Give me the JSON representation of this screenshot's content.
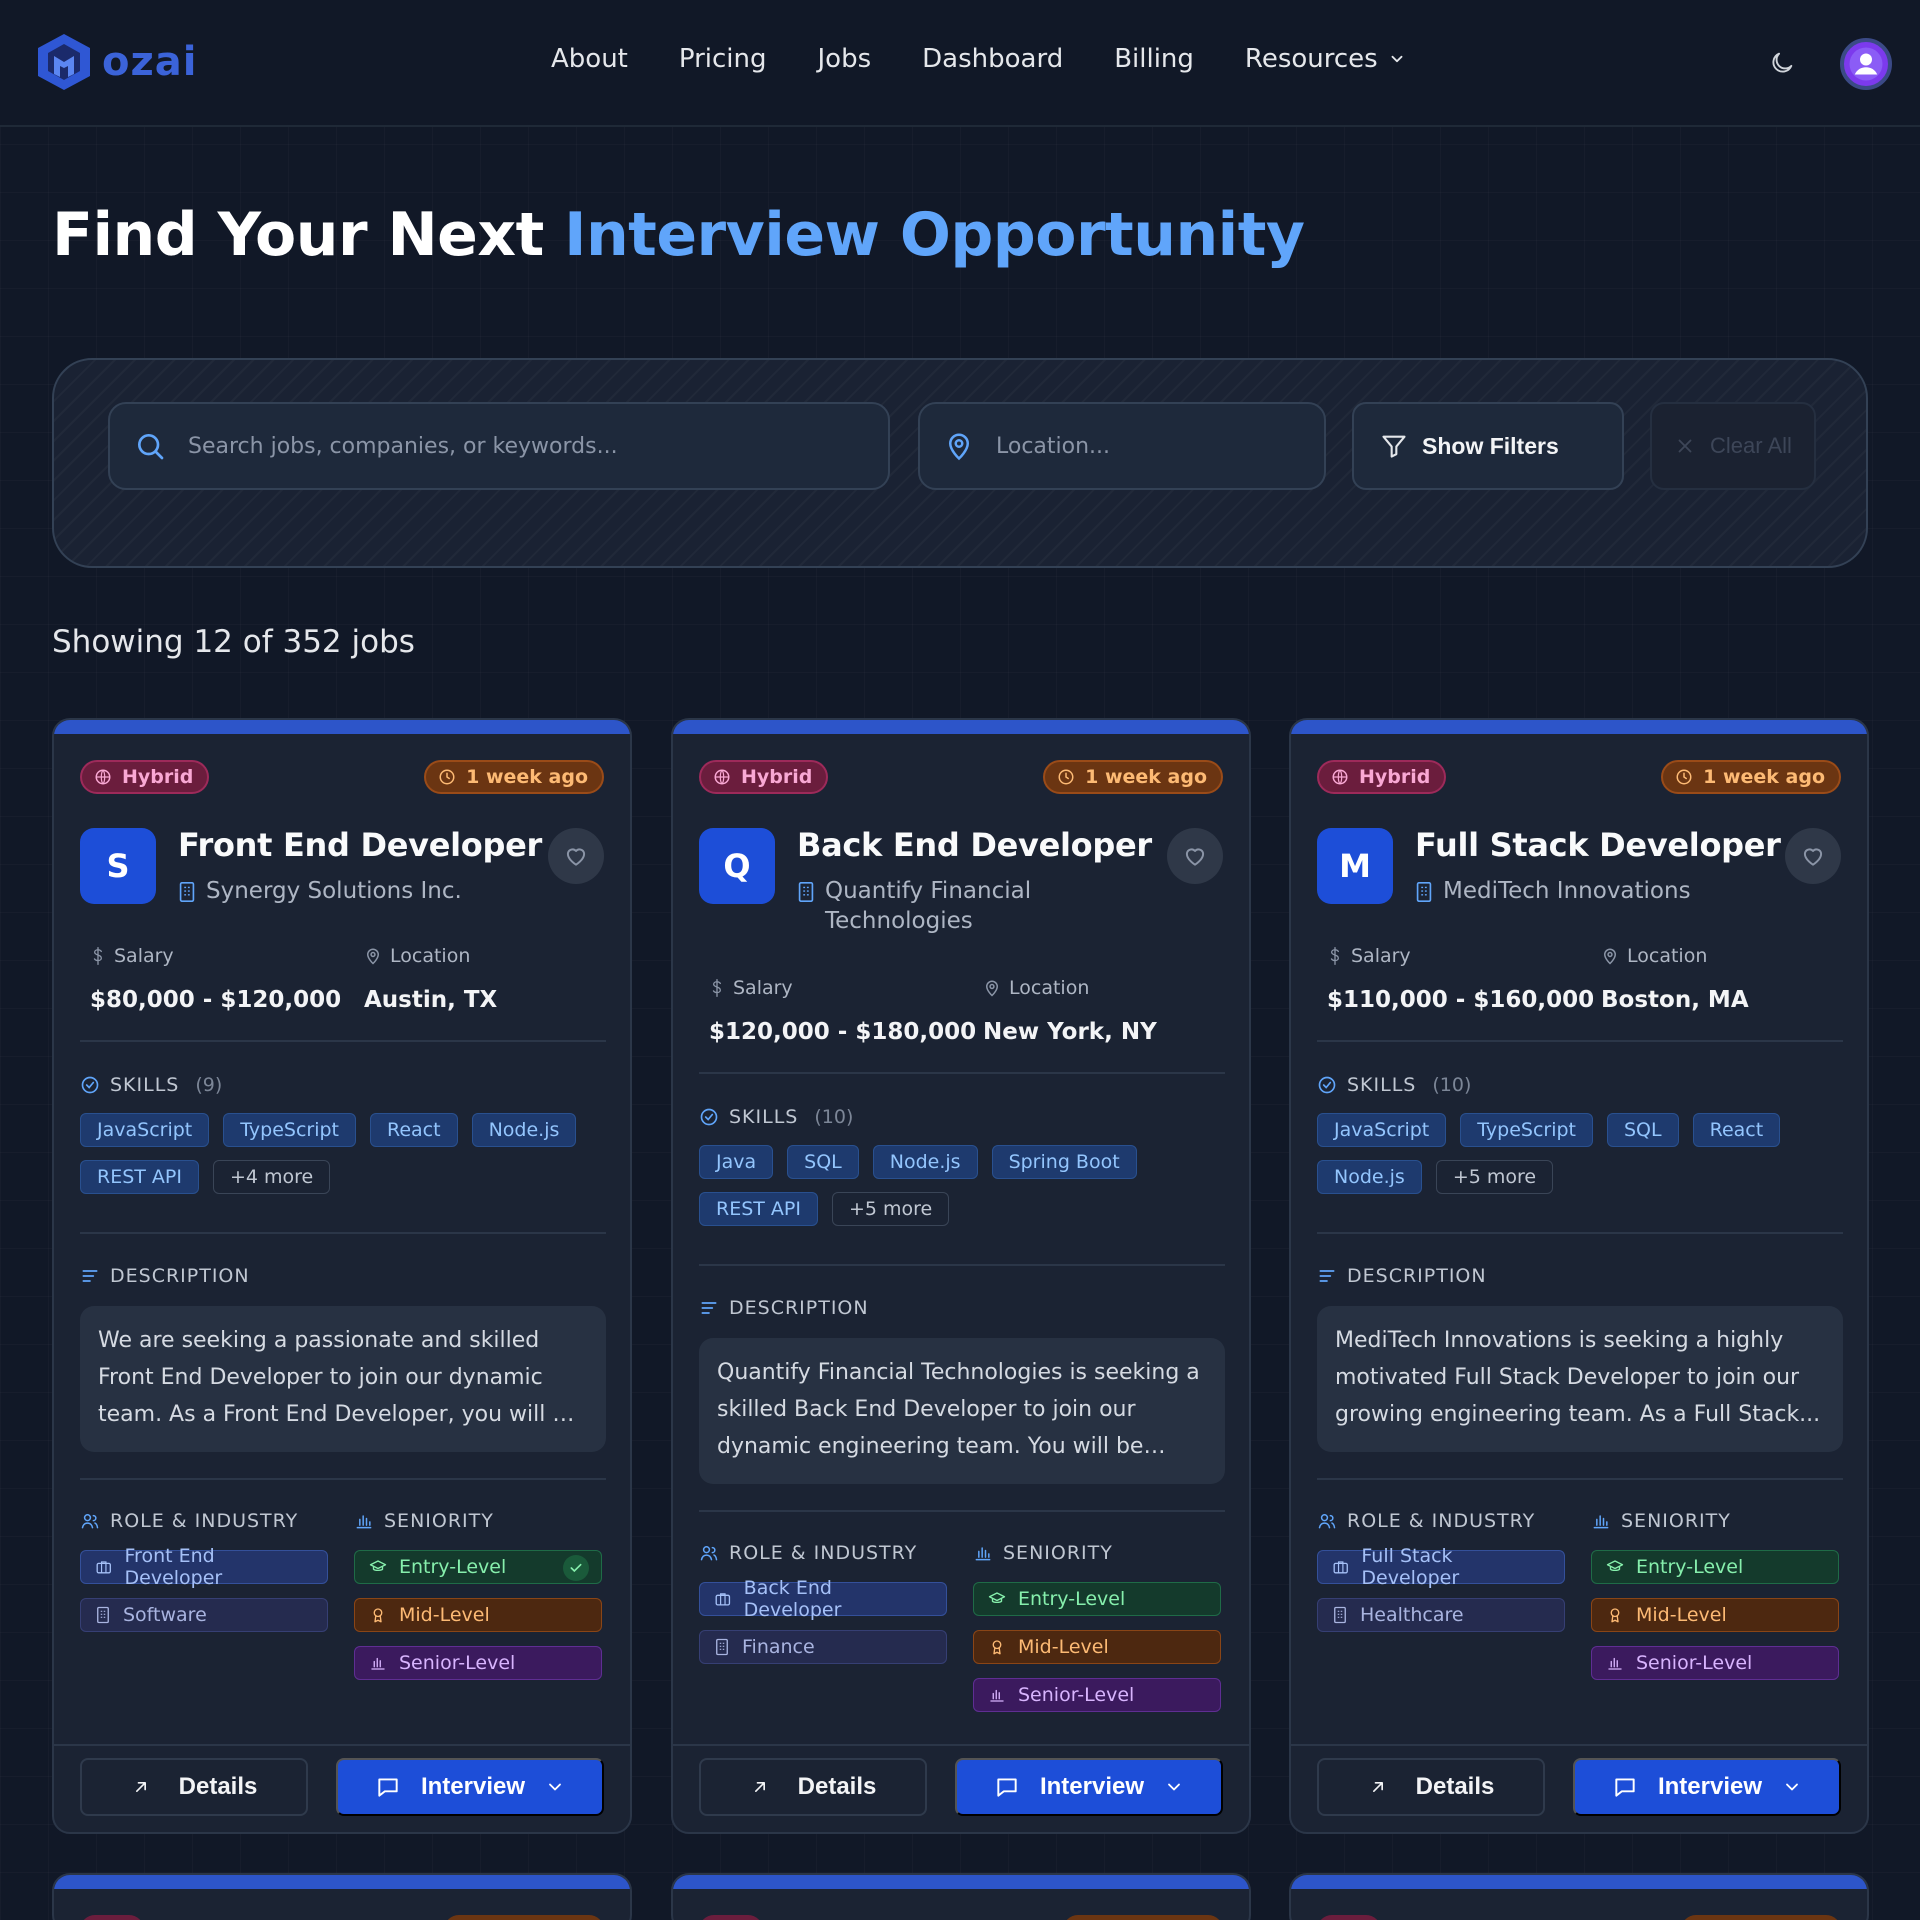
{
  "brand": {
    "name": "ozai",
    "color": "#3b63d9"
  },
  "nav": {
    "links": [
      "About",
      "Pricing",
      "Jobs",
      "Dashboard",
      "Billing",
      "Resources"
    ],
    "theme_toggle_icon": "moon-icon",
    "avatar_icon": "user-avatar-icon"
  },
  "hero": {
    "title_plain": "Find Your Next",
    "title_accent": "Interview Opportunity",
    "accent_color": "#60a5fa"
  },
  "search": {
    "placeholder": "Search jobs, companies, or keywords...",
    "value": "",
    "location_placeholder": "Location...",
    "location_value": "",
    "filters_label": "Show Filters",
    "clear_label": "Clear All"
  },
  "results": {
    "text": "Showing 12 of 352 jobs"
  },
  "labels": {
    "salary": "Salary",
    "location": "Location",
    "skills": "SKILLS",
    "description": "DESCRIPTION",
    "role_industry": "ROLE & INDUSTRY",
    "seniority": "SENIORITY",
    "details": "Details",
    "interview": "Interview"
  },
  "colors": {
    "primary": "#1d4ed8",
    "background": "#111827",
    "card": "#1b2333"
  },
  "cards": [
    {
      "work_type": "Hybrid",
      "posted": "1 week ago",
      "logo_letter": "S",
      "title": "Front End Developer",
      "company": "Synergy Solutions Inc.",
      "salary": "$80,000 - $120,000",
      "location": "Austin, TX",
      "skills_count": "(9)",
      "skills": [
        "JavaScript",
        "TypeScript",
        "React",
        "Node.js",
        "REST API"
      ],
      "more_skills": "+4 more",
      "description": "We are seeking a passionate and skilled Front End Developer to join our dynamic team. As a Front End Developer, you will be responsible f...",
      "role": "Front End Developer",
      "industry": "Software",
      "seniority": [
        "Entry-Level",
        "Mid-Level",
        "Senior-Level"
      ],
      "entry_checked": true
    },
    {
      "work_type": "Hybrid",
      "posted": "1 week ago",
      "logo_letter": "Q",
      "title": "Back End Developer",
      "company": "Quantify Financial Technologies",
      "salary": "$120,000 - $180,000",
      "location": "New York, NY",
      "skills_count": "(10)",
      "skills": [
        "Java",
        "SQL",
        "Node.js",
        "Spring Boot",
        "REST API"
      ],
      "more_skills": "+5 more",
      "description": "Quantify Financial Technologies is seeking a skilled Back End Developer to join our dynamic engineering team. You will be responsible for...",
      "role": "Back End Developer",
      "industry": "Finance",
      "seniority": [
        "Entry-Level",
        "Mid-Level",
        "Senior-Level"
      ],
      "entry_checked": false
    },
    {
      "work_type": "Hybrid",
      "posted": "1 week ago",
      "logo_letter": "M",
      "title": "Full Stack Developer",
      "company": "MediTech Innovations",
      "salary": "$110,000 - $160,000",
      "location": "Boston, MA",
      "skills_count": "(10)",
      "skills": [
        "JavaScript",
        "TypeScript",
        "SQL",
        "React",
        "Node.js"
      ],
      "more_skills": "+5 more",
      "description": "MediTech Innovations is seeking a highly motivated Full Stack Developer to join our growing engineering team. As a Full Stack...",
      "role": "Full Stack Developer",
      "industry": "Healthcare",
      "seniority": [
        "Entry-Level",
        "Mid-Level",
        "Senior-Level"
      ],
      "entry_checked": false
    }
  ]
}
